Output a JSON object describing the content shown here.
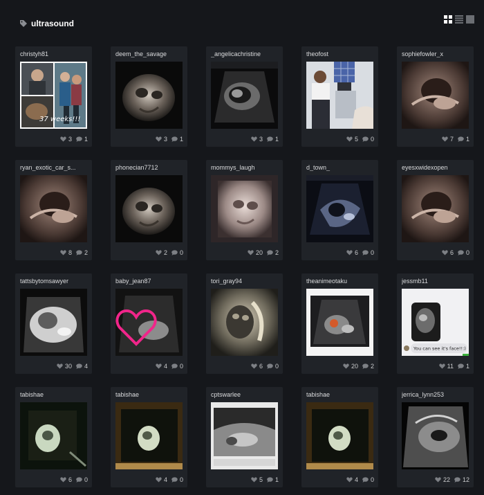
{
  "header": {
    "title": "ultrasound",
    "tag_icon": "tag-icon"
  },
  "view_toggle": [
    "grid-view-icon",
    "list-view-icon",
    "single-view-icon"
  ],
  "posts": [
    {
      "user": "christyh81",
      "likes": "3",
      "comments": "1",
      "kind": "collage",
      "caption": "37 weeks!!!"
    },
    {
      "user": "deem_the_savage",
      "likes": "3",
      "comments": "1",
      "kind": "3d"
    },
    {
      "user": "_angelicachristine",
      "likes": "3",
      "comments": "1",
      "kind": "scan"
    },
    {
      "user": "theofost",
      "likes": "5",
      "comments": "0",
      "kind": "room"
    },
    {
      "user": "sophiefowler_x",
      "likes": "7",
      "comments": "1",
      "kind": "sepia"
    },
    {
      "user": "ryan_exotic_car_s...",
      "likes": "8",
      "comments": "2",
      "kind": "sepia"
    },
    {
      "user": "phonecian7712",
      "likes": "2",
      "comments": "0",
      "kind": "3d"
    },
    {
      "user": "mommys_laugh",
      "likes": "20",
      "comments": "2",
      "kind": "3dpink"
    },
    {
      "user": "d_town_",
      "likes": "6",
      "comments": "0",
      "kind": "bluescan"
    },
    {
      "user": "eyesxwidexopen",
      "likes": "6",
      "comments": "0",
      "kind": "sepia"
    },
    {
      "user": "tattsbytomsawyer",
      "likes": "30",
      "comments": "4",
      "kind": "bright"
    },
    {
      "user": "baby_jean87",
      "likes": "4",
      "comments": "0",
      "kind": "heart"
    },
    {
      "user": "tori_gray94",
      "likes": "6",
      "comments": "0",
      "kind": "vintage"
    },
    {
      "user": "theanimeotaku",
      "likes": "20",
      "comments": "2",
      "kind": "framed"
    },
    {
      "user": "jessmb11",
      "likes": "11",
      "comments": "1",
      "kind": "chat",
      "caption": "You can see it's face!!:)"
    },
    {
      "user": "tabishae",
      "likes": "6",
      "comments": "0",
      "kind": "green"
    },
    {
      "user": "tabishae",
      "likes": "4",
      "comments": "0",
      "kind": "greenwarm"
    },
    {
      "user": "cptswarlee",
      "likes": "5",
      "comments": "1",
      "kind": "paper"
    },
    {
      "user": "tabishae",
      "likes": "4",
      "comments": "0",
      "kind": "greenwarm"
    },
    {
      "user": "jerrica_lynn253",
      "likes": "22",
      "comments": "12",
      "kind": "grayscan"
    }
  ]
}
